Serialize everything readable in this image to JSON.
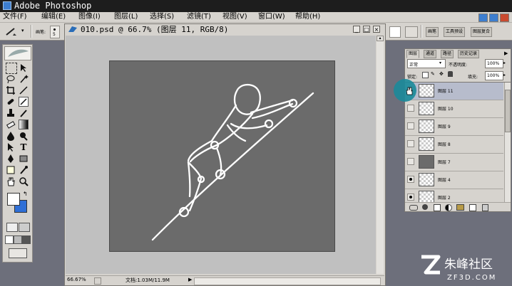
{
  "app": {
    "title": "Adobe Photoshop"
  },
  "menu": [
    "文件(F)",
    "编辑(E)",
    "图像(I)",
    "图层(L)",
    "选择(S)",
    "滤镜(T)",
    "视图(V)",
    "窗口(W)",
    "帮助(H)"
  ],
  "options": {
    "brush_label": "画笔:",
    "brush_size": "5"
  },
  "palette_well": {
    "tabs": [
      "画笔",
      "工具预设",
      "图层复合"
    ]
  },
  "document": {
    "title": "010.psd @ 66.7% (图层 11, RGB/8)",
    "zoom": "66.67%",
    "doc_info": "文档:1.03M/11.9M"
  },
  "layers_panel": {
    "tabs": [
      "图层",
      "通道",
      "路径",
      "历史记录"
    ],
    "blend_mode": "正常",
    "opacity_label": "不透明度:",
    "opacity_value": "100%",
    "lock_label": "锁定:",
    "fill_label": "填充:",
    "fill_value": "100%",
    "layers": [
      {
        "name": "图层 11",
        "visible": true,
        "selected": true,
        "thumb": "sketch"
      },
      {
        "name": "图层 10",
        "visible": false,
        "selected": false,
        "thumb": "transparent"
      },
      {
        "name": "图层 9",
        "visible": false,
        "selected": false,
        "thumb": "transparent"
      },
      {
        "name": "图层 8",
        "visible": false,
        "selected": false,
        "thumb": "transparent"
      },
      {
        "name": "图层 7",
        "visible": false,
        "selected": false,
        "thumb": "gray"
      },
      {
        "name": "图层 4",
        "visible": true,
        "selected": false,
        "thumb": "transparent"
      },
      {
        "name": "图层 2",
        "visible": true,
        "selected": false,
        "thumb": "transparent"
      }
    ]
  },
  "colors": {
    "foreground": "#ffffff",
    "background": "#2f6fd6",
    "canvas": "#6b6b6b",
    "selection_highlight": "#1a8a9a"
  },
  "watermark": {
    "logo_text": "朱峰社区",
    "url_text": "ZF3D.COM"
  }
}
